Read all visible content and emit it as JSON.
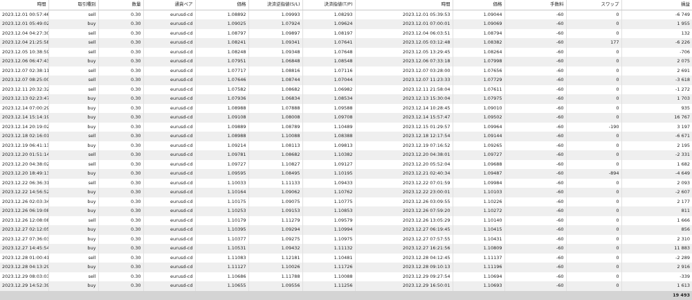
{
  "headers": [
    "時間",
    "取引種別",
    "数量",
    "通貨ペア",
    "価格",
    "決済逆指値(S/L)",
    "決済指値(T/P)",
    "時間",
    "価格",
    "手数料",
    "スワップ",
    "損益"
  ],
  "rows": [
    [
      "2023.12.01 00:57:46",
      "sell",
      "0.30",
      "eurusd-cd",
      "1.08892",
      "1.09993",
      "1.08293",
      "2023.12.01 05:39:53",
      "1.09044",
      "-60",
      "0",
      "-6 749"
    ],
    [
      "2023.12.01 05:49:02",
      "buy",
      "0.30",
      "eurusd-cd",
      "1.09025",
      "1.07924",
      "1.09624",
      "2023.12.01 07:00:01",
      "1.09069",
      "-60",
      "0",
      "1 955"
    ],
    [
      "2023.12.04 04:27:30",
      "sell",
      "0.30",
      "eurusd-cd",
      "1.08797",
      "1.09897",
      "1.08197",
      "2023.12.04 06:03:51",
      "1.08794",
      "-60",
      "0",
      "132"
    ],
    [
      "2023.12.04 21:25:58",
      "sell",
      "0.30",
      "eurusd-cd",
      "1.08241",
      "1.09341",
      "1.07641",
      "2023.12.05 03:12:48",
      "1.08382",
      "-60",
      "177",
      "-6 226"
    ],
    [
      "2023.12.05 10:38:59",
      "sell",
      "0.30",
      "eurusd-cd",
      "1.08248",
      "1.09348",
      "1.07648",
      "2023.12.05 13:29:45",
      "1.08264",
      "-60",
      "0",
      "-706"
    ],
    [
      "2023.12.06 06:47:43",
      "buy",
      "0.30",
      "eurusd-cd",
      "1.07951",
      "1.06848",
      "1.08548",
      "2023.12.06 07:33:18",
      "1.07998",
      "-60",
      "0",
      "2 075"
    ],
    [
      "2023.12.07 02:38:11",
      "sell",
      "0.30",
      "eurusd-cd",
      "1.07717",
      "1.08816",
      "1.07116",
      "2023.12.07 03:28:00",
      "1.07656",
      "-60",
      "0",
      "2 691"
    ],
    [
      "2023.12.07 08:25:00",
      "sell",
      "0.30",
      "eurusd-cd",
      "1.07646",
      "1.08744",
      "1.07044",
      "2023.12.07 11:23:33",
      "1.07729",
      "-60",
      "0",
      "-3 618"
    ],
    [
      "2023.12.11 20:32:32",
      "sell",
      "0.30",
      "eurusd-cd",
      "1.07582",
      "1.08682",
      "1.06982",
      "2023.12.11 21:58:04",
      "1.07611",
      "-60",
      "0",
      "-1 272"
    ],
    [
      "2023.12.13 02:23:47",
      "buy",
      "0.30",
      "eurusd-cd",
      "1.07936",
      "1.06834",
      "1.08534",
      "2023.12.13 15:30:04",
      "1.07975",
      "-60",
      "0",
      "1 703"
    ],
    [
      "2023.12.14 07:00:29",
      "buy",
      "0.30",
      "eurusd-cd",
      "1.08988",
      "1.07888",
      "1.09588",
      "2023.12.14 10:28:45",
      "1.09010",
      "-60",
      "0",
      "935"
    ],
    [
      "2023.12.14 15:14:19",
      "buy",
      "0.30",
      "eurusd-cd",
      "1.09108",
      "1.08008",
      "1.09708",
      "2023.12.14 15:57:47",
      "1.09502",
      "-60",
      "0",
      "16 767"
    ],
    [
      "2023.12.14 20:19:02",
      "buy",
      "0.30",
      "eurusd-cd",
      "1.09889",
      "1.08789",
      "1.10489",
      "2023.12.15 01:29:57",
      "1.09964",
      "-60",
      "-190",
      "3 197"
    ],
    [
      "2023.12.18 02:16:01",
      "sell",
      "0.30",
      "eurusd-cd",
      "1.08988",
      "1.10088",
      "1.08388",
      "2023.12.18 12:17:54",
      "1.09144",
      "-60",
      "0",
      "-6 671"
    ],
    [
      "2023.12.19 06:41:13",
      "buy",
      "0.30",
      "eurusd-cd",
      "1.09214",
      "1.08113",
      "1.09813",
      "2023.12.19 07:16:52",
      "1.09265",
      "-60",
      "0",
      "2 195"
    ],
    [
      "2023.12.20 01:51:14",
      "sell",
      "0.30",
      "eurusd-cd",
      "1.09781",
      "1.08682",
      "1.10382",
      "2023.12.20 04:38:01",
      "1.09727",
      "-60",
      "0",
      "-2 331"
    ],
    [
      "2023.12.20 04:38:02",
      "sell",
      "0.30",
      "eurusd-cd",
      "1.09727",
      "1.10827",
      "1.09127",
      "2023.12.20 05:52:04",
      "1.09688",
      "-60",
      "0",
      "1 682"
    ],
    [
      "2023.12.20 18:49:13",
      "buy",
      "0.30",
      "eurusd-cd",
      "1.09595",
      "1.08495",
      "1.10195",
      "2023.12.21 02:40:34",
      "1.09487",
      "-60",
      "-894",
      "-4 649"
    ],
    [
      "2023.12.22 06:36:31",
      "sell",
      "0.30",
      "eurusd-cd",
      "1.10033",
      "1.11133",
      "1.09433",
      "2023.12.22 07:01:59",
      "1.09984",
      "-60",
      "0",
      "2 093"
    ],
    [
      "2023.12.22 14:56:52",
      "buy",
      "0.30",
      "eurusd-cd",
      "1.10164",
      "1.09062",
      "1.10762",
      "2023.12.22 23:00:01",
      "1.10103",
      "-60",
      "0",
      "-2 607"
    ],
    [
      "2023.12.26 02:03:34",
      "buy",
      "0.30",
      "eurusd-cd",
      "1.10175",
      "1.09075",
      "1.10775",
      "2023.12.26 03:09:55",
      "1.10226",
      "-60",
      "0",
      "2 177"
    ],
    [
      "2023.12.26 06:19:08",
      "buy",
      "0.30",
      "eurusd-cd",
      "1.10253",
      "1.09153",
      "1.10853",
      "2023.12.26 07:59:20",
      "1.10272",
      "-60",
      "0",
      "811"
    ],
    [
      "2023.12.26 12:08:08",
      "sell",
      "0.30",
      "eurusd-cd",
      "1.10179",
      "1.11279",
      "1.09579",
      "2023.12.26 13:05:29",
      "1.10140",
      "-60",
      "0",
      "1 666"
    ],
    [
      "2023.12.27 02:12:05",
      "buy",
      "0.30",
      "eurusd-cd",
      "1.10395",
      "1.09294",
      "1.10994",
      "2023.12.27 06:19:45",
      "1.10415",
      "-60",
      "0",
      "856"
    ],
    [
      "2023.12.27 07:36:03",
      "buy",
      "0.30",
      "eurusd-cd",
      "1.10377",
      "1.09275",
      "1.10975",
      "2023.12.27 07:57:55",
      "1.10431",
      "-60",
      "0",
      "2 310"
    ],
    [
      "2023.12.27 14:45:54",
      "buy",
      "0.30",
      "eurusd-cd",
      "1.10531",
      "1.09432",
      "1.11132",
      "2023.12.27 16:21:56",
      "1.10809",
      "-60",
      "0",
      "11 883"
    ],
    [
      "2023.12.28 01:00:41",
      "sell",
      "0.30",
      "eurusd-cd",
      "1.11083",
      "1.12181",
      "1.10481",
      "2023.12.28 04:12:45",
      "1.11137",
      "-60",
      "0",
      "-2 289"
    ],
    [
      "2023.12.28 04:13:29",
      "buy",
      "0.30",
      "eurusd-cd",
      "1.11127",
      "1.10026",
      "1.11726",
      "2023.12.28 09:10:13",
      "1.11196",
      "-60",
      "0",
      "2 916"
    ],
    [
      "2023.12.29 08:03:03",
      "sell",
      "0.30",
      "eurusd-cd",
      "1.10686",
      "1.11788",
      "1.10088",
      "2023.12.29 09:27:54",
      "1.10694",
      "-60",
      "0",
      "-339"
    ],
    [
      "2023.12.29 14:52:39",
      "buy",
      "0.30",
      "eurusd-cd",
      "1.10655",
      "1.09556",
      "1.11256",
      "2023.12.29 16:50:01",
      "1.10693",
      "-60",
      "0",
      "1 613"
    ]
  ],
  "total": "19 493"
}
